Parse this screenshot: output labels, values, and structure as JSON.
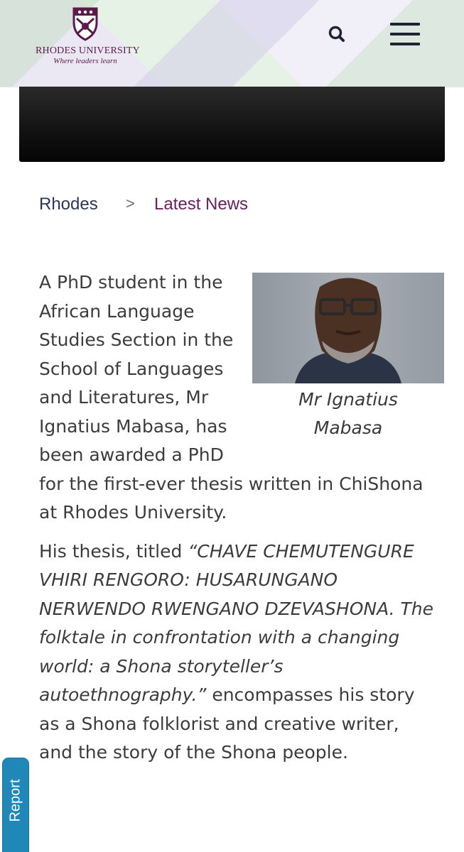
{
  "header": {
    "logo_name": "RHODES UNIVERSITY",
    "logo_tagline": "Where leaders learn",
    "search_icon": "search-icon",
    "menu_icon": "hamburger-menu-icon",
    "brand_color": "#5a1a4a"
  },
  "breadcrumb": {
    "home": "Rhodes",
    "separator": ">",
    "current": "Latest News"
  },
  "article": {
    "photo_caption": "Mr Ignatius Mabasa",
    "paragraph1": "A PhD student in the African Language Studies Section in the School of Languages and Literatures, Mr Ignatius Mabasa, has been awarded a PhD for the first-ever thesis written in ChiShona at Rhodes University.",
    "p2_intro": "His thesis, titled ",
    "p2_title": "“CHAVE CHEMUTENGURE VHIRI RENGORO: HUSARUNGANO NERWENDO RWENGANO DZEVASHONA. The folktale in confrontation with a changing world: a Shona storyteller’s autoethnography.”",
    "p2_rest": " encompasses his story as a Shona folklorist and creative writer, and the story of the Shona people."
  },
  "report_tab": {
    "label": "Report",
    "color": "#1f88b8"
  }
}
